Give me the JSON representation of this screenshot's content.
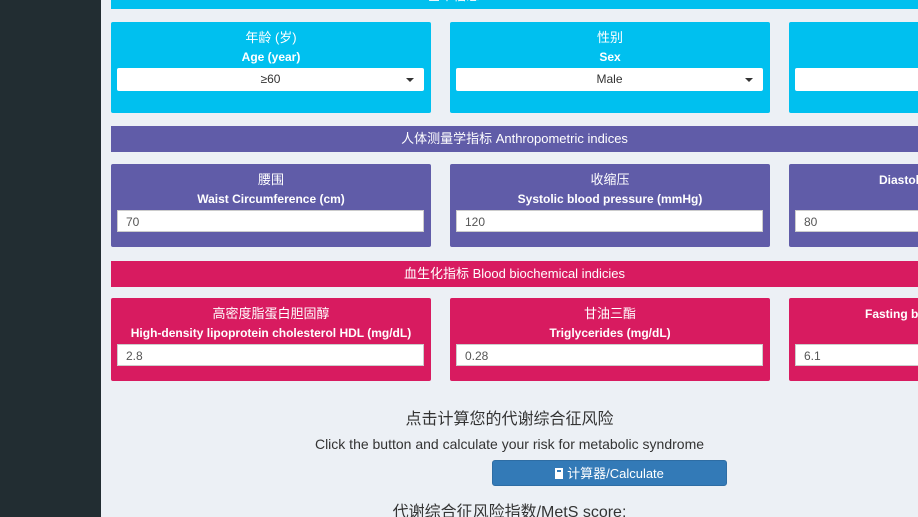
{
  "sections": {
    "basic": "基本信息 Basic characteristics",
    "anthro": "人体测量学指标 Anthropometric indices",
    "bio": "血生化指标 Blood biochemical indicies"
  },
  "basic_cards": [
    {
      "zh": "年龄 (岁)",
      "en": "Age (year)",
      "value": "≥60"
    },
    {
      "zh": "性别",
      "en": "Sex",
      "value": "Male"
    },
    {
      "zh": "",
      "en": "",
      "value": ""
    }
  ],
  "anthro_cards": [
    {
      "zh": "腰围",
      "en": "Waist Circumference (cm)",
      "value": "70"
    },
    {
      "zh": "收缩压",
      "en": "Systolic blood pressure (mmHg)",
      "value": "120"
    },
    {
      "zh": "",
      "en": "Diastolic bl",
      "value": "80"
    }
  ],
  "bio_cards": [
    {
      "zh": "高密度脂蛋白胆固醇",
      "en": "High-density lipoprotein cholesterol HDL (mg/dL)",
      "value": "2.8"
    },
    {
      "zh": "甘油三酯",
      "en": "Triglycerides (mg/dL)",
      "value": "0.28"
    },
    {
      "zh": "",
      "en": "Fasting bl",
      "value": "6.1"
    }
  ],
  "prompt_zh": "点击计算您的代谢综合征风险",
  "prompt_en": "Click the button and calculate your risk for metabolic syndrome",
  "calc_button": "计算器/Calculate",
  "score_label": "代谢综合征风险指数/MetS score:",
  "colors": {
    "basic": "#00c0ef",
    "anthro": "#605ca8",
    "bio": "#d81b60",
    "button": "#337ab7"
  }
}
